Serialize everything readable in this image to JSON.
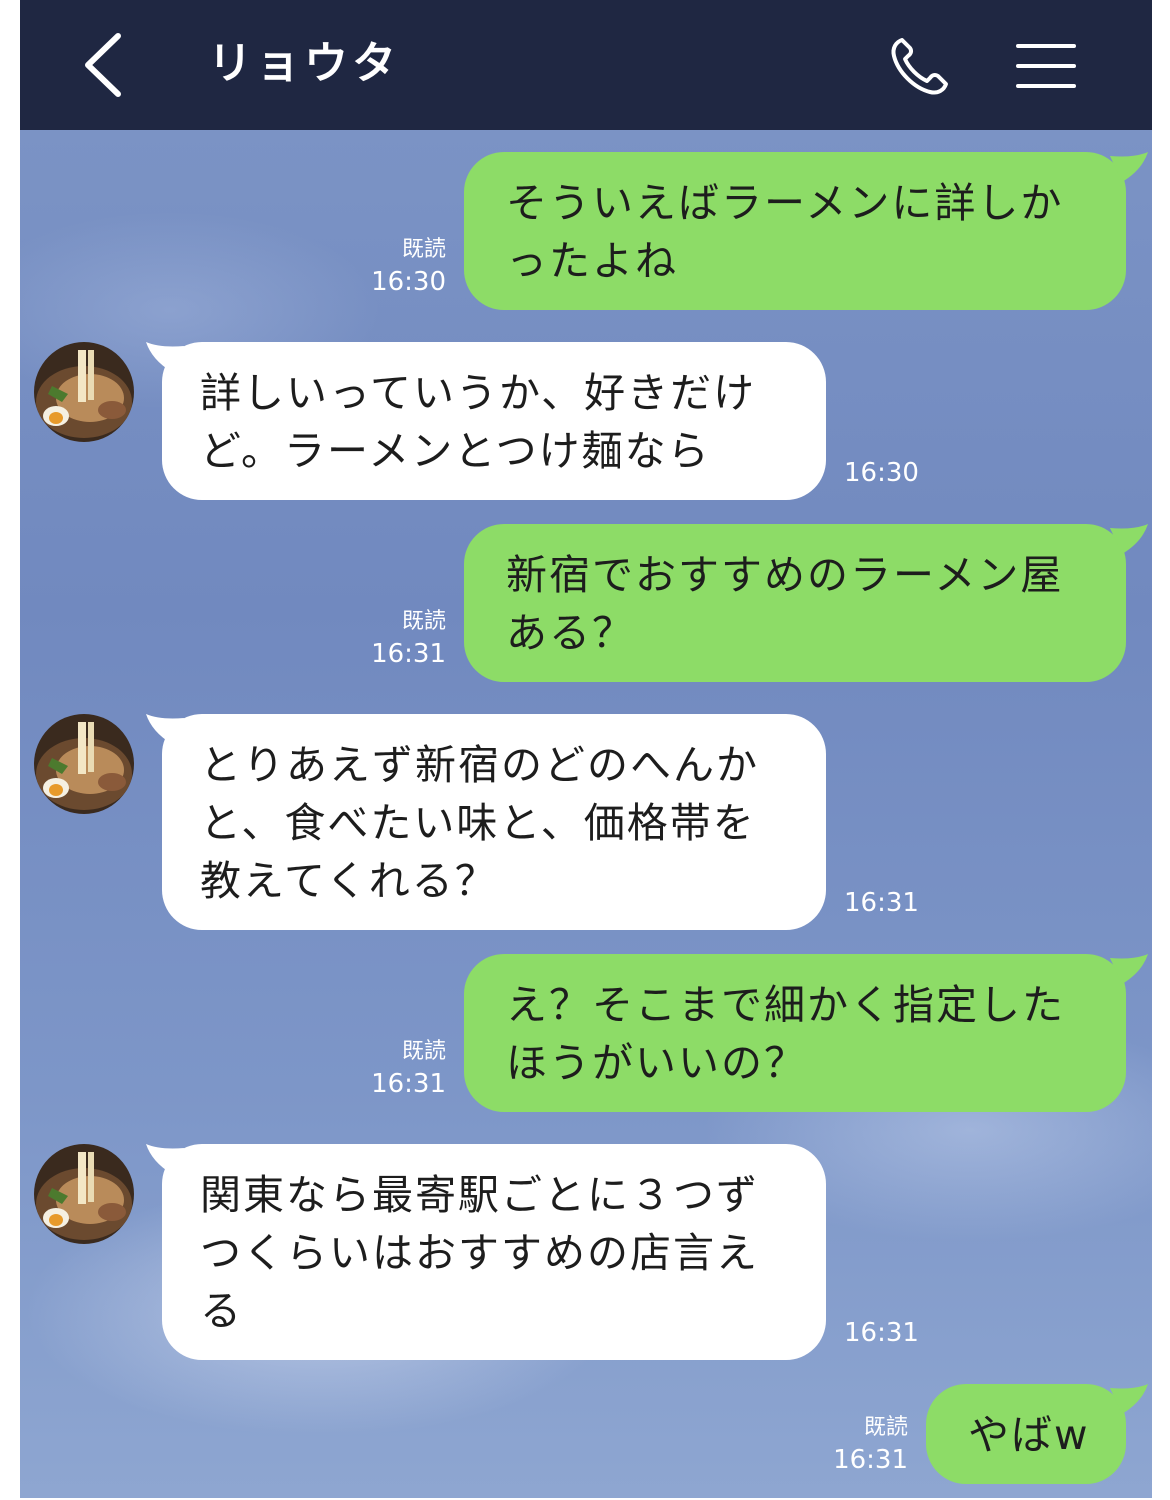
{
  "header": {
    "title": "リョウタ",
    "back_icon": "chevron-left-icon",
    "call_icon": "phone-icon",
    "menu_icon": "hamburger-menu-icon"
  },
  "colors": {
    "header_bg": "#1f2742",
    "chat_bg": "#7b93c5",
    "sent_bubble": "#8ddc67",
    "received_bubble": "#ffffff"
  },
  "messages": [
    {
      "from": "me",
      "text": "そういえばラーメンに詳しか\nったよね",
      "read": "既読",
      "time": "16:30"
    },
    {
      "from": "ryota",
      "text": "詳しいっていうか、好きだけ\nど。ラーメンとつけ麺なら",
      "time": "16:30"
    },
    {
      "from": "me",
      "text": "新宿でおすすめのラーメン屋\nある？",
      "read": "既読",
      "time": "16:31"
    },
    {
      "from": "ryota",
      "text": "とりあえず新宿のどのへんか\nと、食べたい味と、価格帯を\n教えてくれる？",
      "time": "16:31"
    },
    {
      "from": "me",
      "text": "え？そこまで細かく指定した\nほうがいいの？",
      "read": "既読",
      "time": "16:31"
    },
    {
      "from": "ryota",
      "text": "関東なら最寄駅ごとに３つず\nつくらいはおすすめの店言え\nる",
      "time": "16:31"
    },
    {
      "from": "me",
      "text": "やばw",
      "read": "既読",
      "time": "16:31"
    }
  ]
}
